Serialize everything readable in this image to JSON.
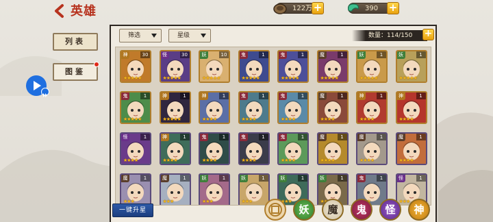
{
  "header": {
    "title": "英雄",
    "coins": "122万",
    "jade": "390"
  },
  "tabs": [
    {
      "label": "列表",
      "active": true
    },
    {
      "label": "图鉴",
      "active": false,
      "has_dot": true
    }
  ],
  "filters": {
    "filter_label": "筛选",
    "star_label": "星级"
  },
  "inventory": {
    "count_text": "数量：114/150"
  },
  "heroes": [
    {
      "faction": "神",
      "level": "30",
      "stars": "★★★★★",
      "color": "#c07a2a"
    },
    {
      "faction": "怪",
      "level": "30",
      "stars": "★★★★★",
      "color": "#5a3d86"
    },
    {
      "faction": "妖",
      "level": "10",
      "stars": "★★★★★",
      "color": "#d9b070"
    },
    {
      "faction": "鬼",
      "level": "1",
      "stars": "★★★★★",
      "color": "#3e4b8f"
    },
    {
      "faction": "鬼",
      "level": "1",
      "stars": "★★★★★",
      "color": "#4d4f9a"
    },
    {
      "faction": "魔",
      "level": "1",
      "stars": "★★★★★",
      "color": "#7a3b6b"
    },
    {
      "faction": "妖",
      "level": "1",
      "stars": "★★★★★",
      "color": "#c99a4a"
    },
    {
      "faction": "妖",
      "level": "1",
      "stars": "★★★★★",
      "color": "#b8a05a"
    },
    {
      "faction": "鬼",
      "level": "1",
      "stars": "★★★★★",
      "color": "#4d8c4a"
    },
    {
      "faction": "神",
      "level": "1",
      "stars": "★★★★★",
      "color": "#30263f"
    },
    {
      "faction": "神",
      "level": "1",
      "stars": "★★★★",
      "color": "#5b6fa6"
    },
    {
      "faction": "鬼",
      "level": "1",
      "stars": "★★★★",
      "color": "#4e7b8c"
    },
    {
      "faction": "鬼",
      "level": "1",
      "stars": "★★★★",
      "color": "#5a8aa8"
    },
    {
      "faction": "魔",
      "level": "1",
      "stars": "★★★★",
      "color": "#8a4a3a"
    },
    {
      "faction": "神",
      "level": "1",
      "stars": "★★★★",
      "color": "#b13a2f"
    },
    {
      "faction": "神",
      "level": "1",
      "stars": "★★★★",
      "color": "#b5352c"
    },
    {
      "faction": "怪",
      "level": "1",
      "stars": "★★★★",
      "color": "#6a3b8a"
    },
    {
      "faction": "神",
      "level": "1",
      "stars": "★★★★",
      "color": "#3f6d5a"
    },
    {
      "faction": "鬼",
      "level": "1",
      "stars": "★★★★",
      "color": "#2f4c48"
    },
    {
      "faction": "鬼",
      "level": "1",
      "stars": "★★★★",
      "color": "#3b3c4a"
    },
    {
      "faction": "鬼",
      "level": "1",
      "stars": "★★★★",
      "color": "#5c9a5a"
    },
    {
      "faction": "魔",
      "level": "1",
      "stars": "★★★★",
      "color": "#b58a2c"
    },
    {
      "faction": "魔",
      "level": "1",
      "stars": "★★★★",
      "color": "#a3998c"
    },
    {
      "faction": "魔",
      "level": "1",
      "stars": "★★★★",
      "color": "#c26d3b"
    },
    {
      "faction": "魔",
      "level": "1",
      "stars": "★★★",
      "color": "#9a8fb0"
    },
    {
      "faction": "魔",
      "level": "1",
      "stars": "★★★",
      "color": "#a6b0c0"
    },
    {
      "faction": "妖",
      "level": "1",
      "stars": "★★★",
      "color": "#a46a8a"
    },
    {
      "faction": "妖",
      "level": "1",
      "stars": "★★★",
      "color": "#c8a66a"
    },
    {
      "faction": "妖",
      "level": "1",
      "stars": "★★★",
      "color": "#3e6b5a"
    },
    {
      "faction": "妖",
      "level": "1",
      "stars": "★★★",
      "color": "#7a6a4a"
    },
    {
      "faction": "鬼",
      "level": "1",
      "stars": "★★★",
      "color": "#6f7a8a"
    },
    {
      "faction": "怪",
      "level": "1",
      "stars": "★★★",
      "color": "#c2b6a0"
    }
  ],
  "bottom": {
    "upgrade_label": "一键升星",
    "faction_filters": [
      "妖",
      "魔",
      "鬼",
      "怪",
      "神"
    ]
  },
  "colors": {
    "title_red": "#b7331e",
    "gold": "#e9a20f",
    "panel_dark": "#2c2621"
  }
}
